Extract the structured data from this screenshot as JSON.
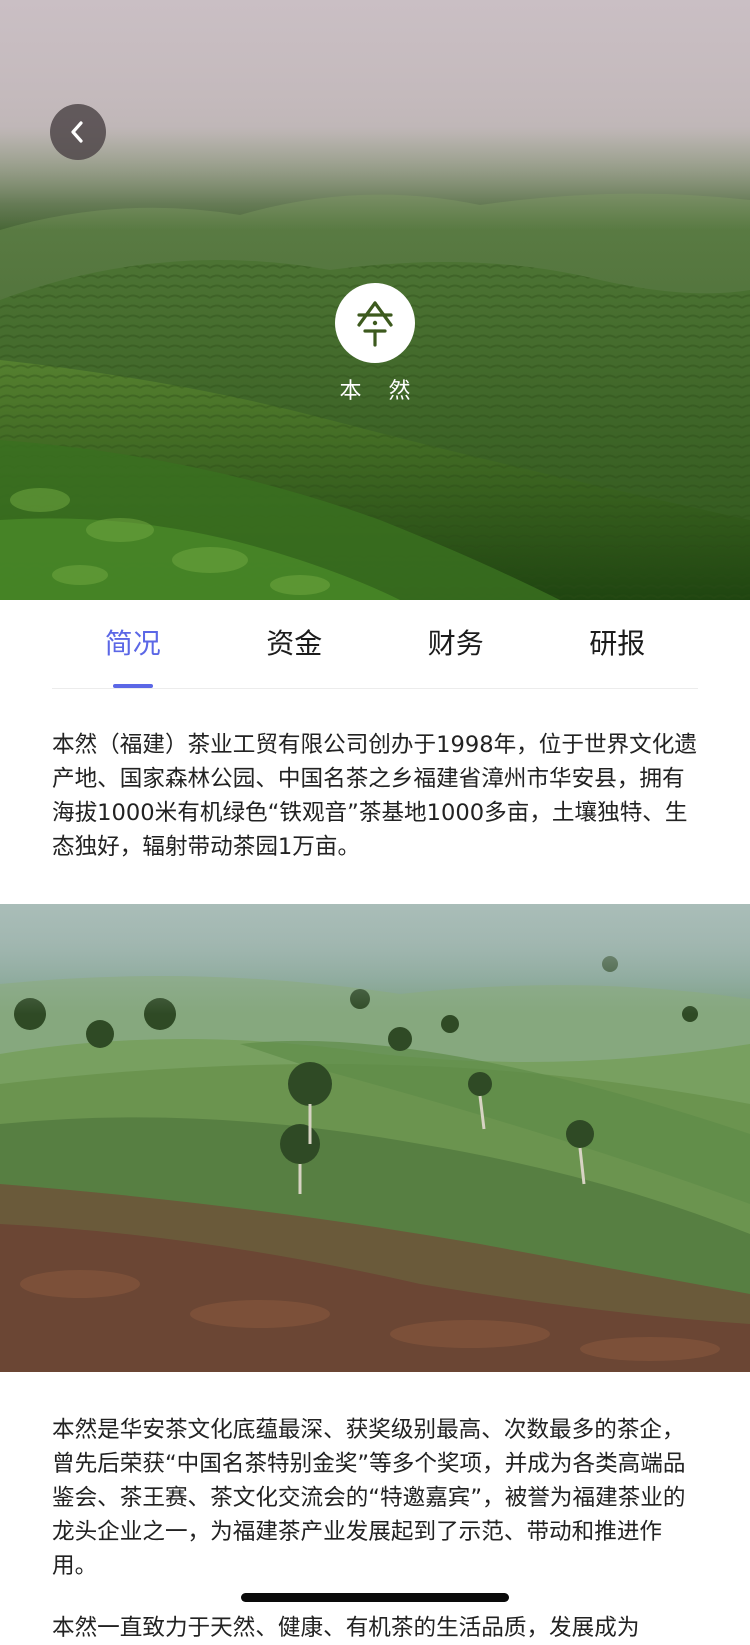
{
  "hero": {
    "brand_name": "本 然"
  },
  "tabs": [
    {
      "label": "简况",
      "active": true
    },
    {
      "label": "资金",
      "active": false
    },
    {
      "label": "财务",
      "active": false
    },
    {
      "label": "研报",
      "active": false
    }
  ],
  "content": {
    "paragraph_1": "本然（福建）茶业工贸有限公司创办于1998年，位于世界文化遗产地、国家森林公园、中国名茶之乡福建省漳州市华安县，拥有海拔1000米有机绿色“铁观音”茶基地1000多亩，土壤独特、生态独好，辐射带动茶园1万亩。",
    "paragraph_2": "本然是华安茶文化底蕴最深、获奖级别最高、次数最多的茶企，曾先后荣获“中国名茶特别金奖”等多个奖项，并成为各类高端品鉴会、茶王赛、茶文化交流会的“特邀嘉宾”，被誉为福建茶业的龙头企业之一，为福建茶产业发展起到了示范、带动和推进作用。",
    "paragraph_3": "本然一直致力于天然、健康、有机茶的生活品质，发展成为"
  },
  "colors": {
    "accent": "#5b67e6",
    "text": "#222222",
    "tab_text": "#1c1c1c",
    "divider": "#ececec",
    "logo_green": "#3d5a1e"
  },
  "icons": {
    "back": "chevron-left-icon",
    "logo": "tea-character-logo-icon"
  }
}
